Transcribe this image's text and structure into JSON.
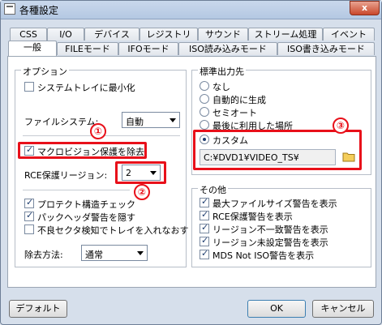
{
  "window": {
    "title": "各種設定",
    "close_label": "x"
  },
  "tabs_row1": [
    "CSS",
    "I/O",
    "デバイス",
    "レジストリ",
    "サウンド",
    "ストリーム処理",
    "イベント"
  ],
  "tabs_row2": [
    "一般",
    "FILEモード",
    "IFOモード",
    "ISO読み込みモード",
    "ISO書き込みモード"
  ],
  "active_tab": "一般",
  "options": {
    "legend": "オプション",
    "minimize_tray": {
      "label": "システムトレイに最小化",
      "checked": false
    },
    "filesystem_label": "ファイルシステム:",
    "filesystem_value": "自動",
    "macrovision": {
      "label": "マクロビジョン保護を除去",
      "checked": true
    },
    "rce_label": "RCE保護リージョン:",
    "rce_value": "2",
    "protect_check": {
      "label": "プロテクト構造チェック",
      "checked": true
    },
    "hide_pack": {
      "label": "パックヘッダ警告を隠す",
      "checked": true
    },
    "bad_sector": {
      "label": "不良セクタ検知でトレイを入れなおす",
      "checked": false
    },
    "removal_label": "除去方法:",
    "removal_value": "通常"
  },
  "output": {
    "legend": "標準出力先",
    "radios": [
      {
        "label": "なし",
        "checked": false
      },
      {
        "label": "自動的に生成",
        "checked": false
      },
      {
        "label": "セミオート",
        "checked": false
      },
      {
        "label": "最後に利用した場所",
        "checked": false
      },
      {
        "label": "カスタム",
        "checked": true
      }
    ],
    "path": "C:¥DVD1¥VIDEO_TS¥"
  },
  "other": {
    "legend": "その他",
    "items": [
      {
        "label": "最大ファイルサイズ警告を表示",
        "checked": true
      },
      {
        "label": "RCE保護警告を表示",
        "checked": true
      },
      {
        "label": "リージョン不一致警告を表示",
        "checked": true
      },
      {
        "label": "リージョン未設定警告を表示",
        "checked": true
      },
      {
        "label": "MDS Not ISO警告を表示",
        "checked": true
      }
    ]
  },
  "annotations": [
    "①",
    "②",
    "③"
  ],
  "buttons": {
    "default": "デフォルト",
    "ok": "OK",
    "cancel": "キャンセル"
  },
  "colors": {
    "highlight_red": "#e8101a",
    "panel_bg": "#ffffff",
    "window_bg": "#d6dfeb"
  }
}
